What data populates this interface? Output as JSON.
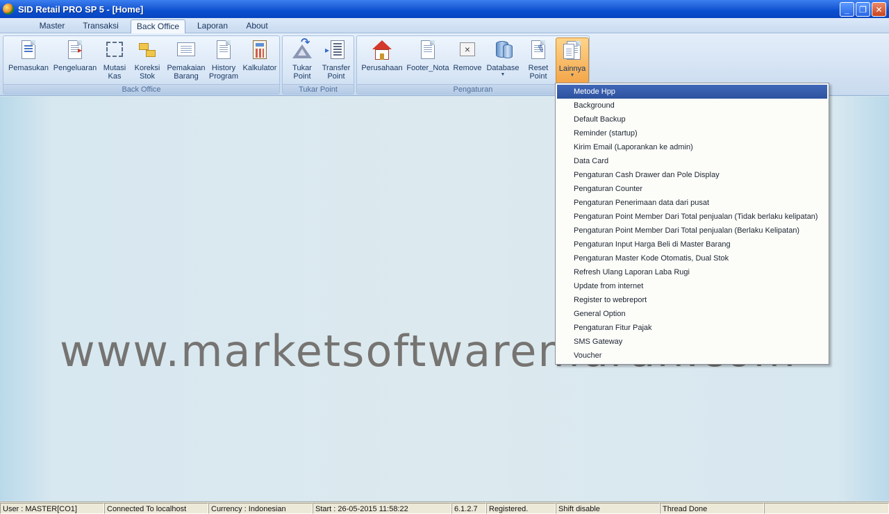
{
  "window": {
    "title": "SID Retail PRO SP 5 - [Home]"
  },
  "tabs": [
    {
      "label": "Master"
    },
    {
      "label": "Transaksi"
    },
    {
      "label": "Back Office"
    },
    {
      "label": "Laporan"
    },
    {
      "label": "About"
    }
  ],
  "active_tab": "Back Office",
  "ribbon": {
    "back_office": {
      "label": "Back Office",
      "buttons": [
        {
          "line1": "Pemasukan",
          "line2": ""
        },
        {
          "line1": "Pengeluaran",
          "line2": ""
        },
        {
          "line1": "Mutasi",
          "line2": "Kas"
        },
        {
          "line1": "Koreksi",
          "line2": "Stok"
        },
        {
          "line1": "Pemakaian",
          "line2": "Barang"
        },
        {
          "line1": "History",
          "line2": "Program"
        },
        {
          "line1": "Kalkulator",
          "line2": ""
        }
      ]
    },
    "tukar_point": {
      "label": "Tukar Point",
      "buttons": [
        {
          "line1": "Tukar",
          "line2": "Point"
        },
        {
          "line1": "Transfer",
          "line2": "Point"
        }
      ]
    },
    "pengaturan": {
      "label": "Pengaturan",
      "buttons": [
        {
          "line1": "Perusahaan",
          "line2": ""
        },
        {
          "line1": "Footer_Nota",
          "line2": ""
        },
        {
          "line1": "Remove",
          "line2": ""
        },
        {
          "line1": "Database",
          "line2": ""
        },
        {
          "line1": "Reset",
          "line2": "Point"
        },
        {
          "line1": "Lainnya",
          "line2": ""
        }
      ]
    }
  },
  "dropdown": {
    "items": [
      "Metode Hpp",
      "Background",
      "Default Backup",
      "Reminder (startup)",
      "Kirim Email (Laporankan ke admin)",
      "Data Card",
      "Pengaturan Cash Drawer dan Pole Display",
      "Pengaturan Counter",
      "Pengaturan Penerimaan data dari pusat",
      "Pengaturan Point Member Dari Total penjualan (Tidak berlaku kelipatan)",
      "Pengaturan Point Member Dari Total penjualan (Berlaku Kelipatan)",
      "Pengaturan Input Harga Beli di Master Barang",
      "Pengaturan Master Kode Otomatis, Dual Stok",
      "Refresh Ulang Laporan Laba Rugi",
      "Update from internet",
      "Register to webreport",
      "General Option",
      "Pengaturan Fitur Pajak",
      "SMS Gateway",
      "Voucher"
    ],
    "highlighted": "Metode Hpp"
  },
  "watermark": "www.marketsoftwaremurah.com",
  "statusbar": [
    "User : MASTER[CO1]",
    "Connected To localhost",
    "Currency : Indonesian",
    "Start  : 26-05-2015 11:58:22",
    "6.1.2.7",
    "Registered.",
    "Shift disable",
    "Thread Done",
    ""
  ],
  "colors": {
    "titlebar": "#0a4fd0",
    "menu_highlight": "#3559a8",
    "lainnya_active": "#f3a64a",
    "background": "#d8e8f0"
  },
  "icons": {
    "app": "app-icon",
    "minimize": "minimize-icon",
    "restore": "restore-icon",
    "close": "close-icon"
  }
}
